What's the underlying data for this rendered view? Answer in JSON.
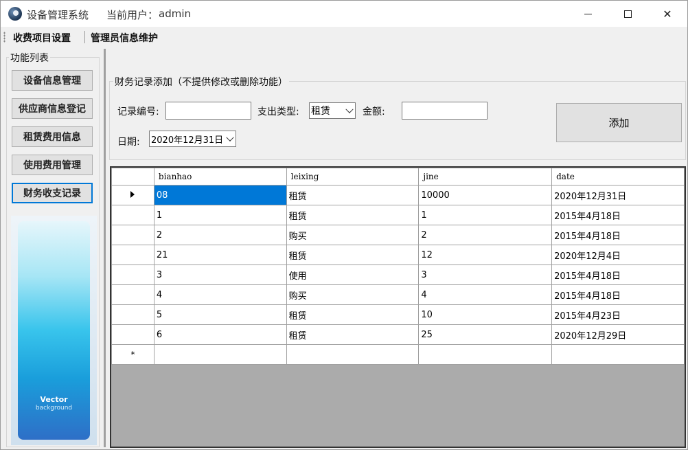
{
  "titlebar": {
    "app_title": "设备管理系统",
    "user_label": "当前用户：",
    "user": "admin"
  },
  "menu": {
    "items": [
      "收费项目设置",
      "管理员信息维护"
    ]
  },
  "sidebar": {
    "group_label": "功能列表",
    "buttons": [
      "设备信息管理",
      "供应商信息登记",
      "租赁费用信息",
      "使用费用管理",
      "财务收支记录"
    ],
    "active_index": 4,
    "banner": {
      "title": "Vector",
      "subtitle": "background"
    }
  },
  "form": {
    "group_label": "财务记录添加（不提供修改或删除功能）",
    "record_no_label": "记录编号:",
    "record_no_value": "",
    "type_label": "支出类型:",
    "type_value": "租赁",
    "amount_label": "金额:",
    "amount_value": "",
    "date_label": "日期:",
    "date_value": "2020年12月31日",
    "add_button": "添加"
  },
  "grid": {
    "columns": [
      "bianhao",
      "leixing",
      "jine",
      "date"
    ],
    "rows": [
      [
        "08",
        "租赁",
        "10000",
        "2020年12月31日"
      ],
      [
        "1",
        "租赁",
        "1",
        "2015年4月18日"
      ],
      [
        "2",
        "购买",
        "2",
        "2015年4月18日"
      ],
      [
        "21",
        "租赁",
        "12",
        "2020年12月4日"
      ],
      [
        "3",
        "使用",
        "3",
        "2015年4月18日"
      ],
      [
        "4",
        "购买",
        "4",
        "2015年4月18日"
      ],
      [
        "5",
        "租赁",
        "10",
        "2015年4月23日"
      ],
      [
        "6",
        "租赁",
        "25",
        "2020年12月29日"
      ]
    ],
    "new_row_marker": "*",
    "selected_row": 0
  },
  "colors": {
    "selection": "#0078d7",
    "grid_background": "#ababab"
  }
}
